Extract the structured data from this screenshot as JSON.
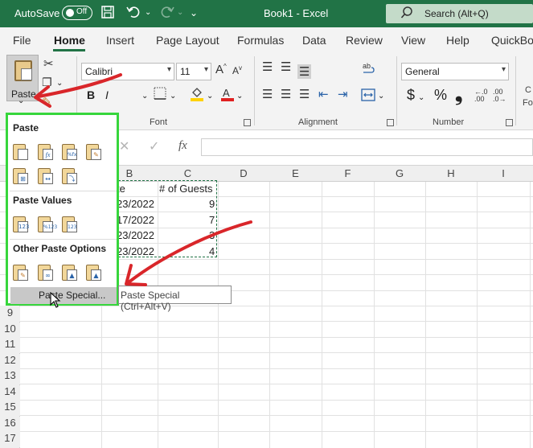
{
  "titlebar": {
    "autosave_label": "AutoSave",
    "autosave_state": "Off",
    "doc_title": "Book1  -  Excel",
    "search_placeholder": "Search (Alt+Q)"
  },
  "menu": {
    "items": [
      "File",
      "Home",
      "Insert",
      "Page Layout",
      "Formulas",
      "Data",
      "Review",
      "View",
      "Help",
      "QuickBo"
    ],
    "active": "Home"
  },
  "ribbon": {
    "paste_label": "Paste",
    "font_name": "Calibri",
    "font_size": "11",
    "number_format": "General",
    "bold": "B",
    "italic": "I",
    "grow_font": "A",
    "shrink_font": "A",
    "currency": "$",
    "percent": "%",
    "comma": "❟",
    "inc_dec": ".00",
    "dec_dec": ".0",
    "group_font": "Font",
    "group_alignment": "Alignment",
    "group_number": "Number",
    "side_c": "C",
    "side_fo": "Fo"
  },
  "formula_bar": {
    "fx": "fx"
  },
  "grid": {
    "columns": [
      "B",
      "C",
      "D",
      "E",
      "F",
      "G",
      "H",
      "I"
    ],
    "rows": [
      "9",
      "10",
      "11",
      "12",
      "13",
      "14",
      "15",
      "16",
      "17"
    ],
    "cells": {
      "b1": "te",
      "c1": "# of Guests",
      "b2": "23/2022",
      "c2": "9",
      "b3": "17/2022",
      "c3": "7",
      "b4": "23/2022",
      "c4": "3",
      "b5": "23/2022",
      "c5": "4"
    }
  },
  "paste_menu": {
    "paste_header": "Paste",
    "values_header": "Paste Values",
    "other_header": "Other Paste Options",
    "paste_special": "Paste Special...",
    "tooltip": "Paste Special (Ctrl+Alt+V)",
    "icon_glyphs": {
      "fx": "fx",
      "pct_fx": "%fx",
      "v123": "123",
      "pct123": "%123",
      "brush123": "123"
    }
  },
  "colors": {
    "title_bar": "#217346",
    "highlight_border": "#37d63c",
    "annotation_arrow": "#d9262a",
    "fill_yellow": "#ffd200",
    "font_red": "#e02020"
  }
}
